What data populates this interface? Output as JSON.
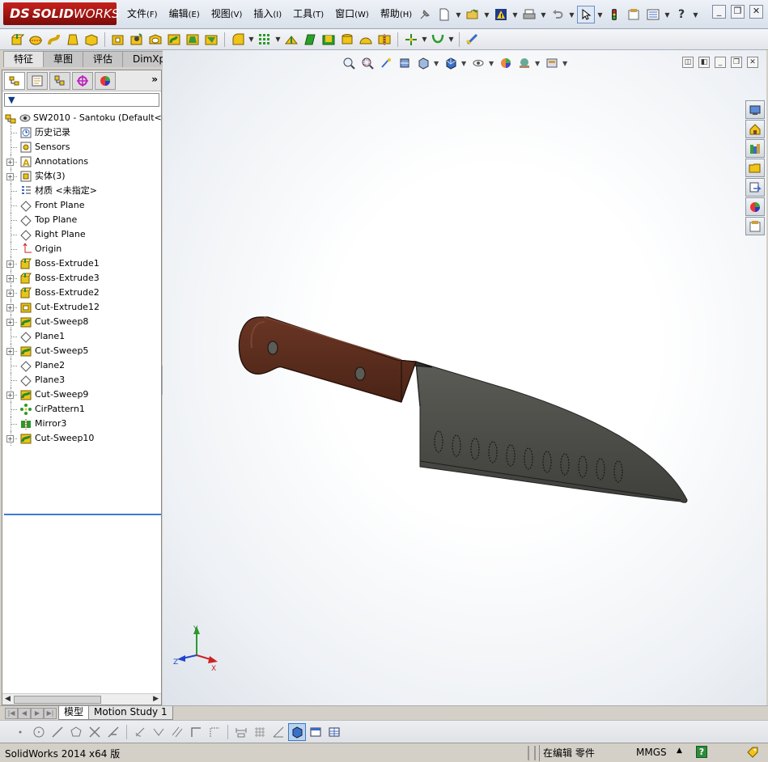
{
  "app": {
    "logo_prefix": "DS",
    "logo_bold": "SOLID",
    "logo_light": "WORKS"
  },
  "menu": [
    {
      "label": "文件",
      "accel": "(F)"
    },
    {
      "label": "编辑",
      "accel": "(E)"
    },
    {
      "label": "视图",
      "accel": "(V)"
    },
    {
      "label": "插入",
      "accel": "(I)"
    },
    {
      "label": "工具",
      "accel": "(T)"
    },
    {
      "label": "窗口",
      "accel": "(W)"
    },
    {
      "label": "帮助",
      "accel": "(H)"
    }
  ],
  "command_tabs": [
    "特征",
    "草图",
    "评估",
    "DimXpert"
  ],
  "tree": {
    "root": "SW2010 - Santoku  (Default<<D",
    "items": [
      {
        "label": "历史记录",
        "icon": "history-icon",
        "expand": false
      },
      {
        "label": "Sensors",
        "icon": "sensor-icon",
        "expand": false
      },
      {
        "label": "Annotations",
        "icon": "annotations-icon",
        "expand": true
      },
      {
        "label": "实体(3)",
        "icon": "solid-bodies-icon",
        "expand": true
      },
      {
        "label": "材质 <未指定>",
        "icon": "material-icon",
        "expand": false
      },
      {
        "label": "Front Plane",
        "icon": "plane-icon",
        "expand": false
      },
      {
        "label": "Top Plane",
        "icon": "plane-icon",
        "expand": false
      },
      {
        "label": "Right Plane",
        "icon": "plane-icon",
        "expand": false
      },
      {
        "label": "Origin",
        "icon": "origin-icon",
        "expand": false
      },
      {
        "label": "Boss-Extrude1",
        "icon": "boss-extrude-icon",
        "expand": true
      },
      {
        "label": "Boss-Extrude3",
        "icon": "boss-extrude-icon",
        "expand": true
      },
      {
        "label": "Boss-Extrude2",
        "icon": "boss-extrude-icon",
        "expand": true
      },
      {
        "label": "Cut-Extrude12",
        "icon": "cut-extrude-icon",
        "expand": true
      },
      {
        "label": "Cut-Sweep8",
        "icon": "cut-sweep-icon",
        "expand": true
      },
      {
        "label": "Plane1",
        "icon": "plane-icon",
        "expand": false
      },
      {
        "label": "Cut-Sweep5",
        "icon": "cut-sweep-icon",
        "expand": true
      },
      {
        "label": "Plane2",
        "icon": "plane-icon",
        "expand": false
      },
      {
        "label": "Plane3",
        "icon": "plane-icon",
        "expand": false
      },
      {
        "label": "Cut-Sweep9",
        "icon": "cut-sweep-icon",
        "expand": true
      },
      {
        "label": "CirPattern1",
        "icon": "circular-pattern-icon",
        "expand": false
      },
      {
        "label": "Mirror3",
        "icon": "mirror-icon",
        "expand": false
      },
      {
        "label": "Cut-Sweep10",
        "icon": "cut-sweep-icon",
        "expand": true
      }
    ]
  },
  "bottom_tabs": [
    "模型",
    "Motion Study 1"
  ],
  "status": {
    "version": "SolidWorks 2014 x64 版",
    "editing": "在编辑 零件",
    "units": "MMGS",
    "help": "?"
  },
  "triad": {
    "x": "X",
    "y": "Y",
    "z": "Z"
  },
  "colors": {
    "handle": "#5a2d1e",
    "blade": "#4f4f4b",
    "accent": "#3a7bd5"
  }
}
